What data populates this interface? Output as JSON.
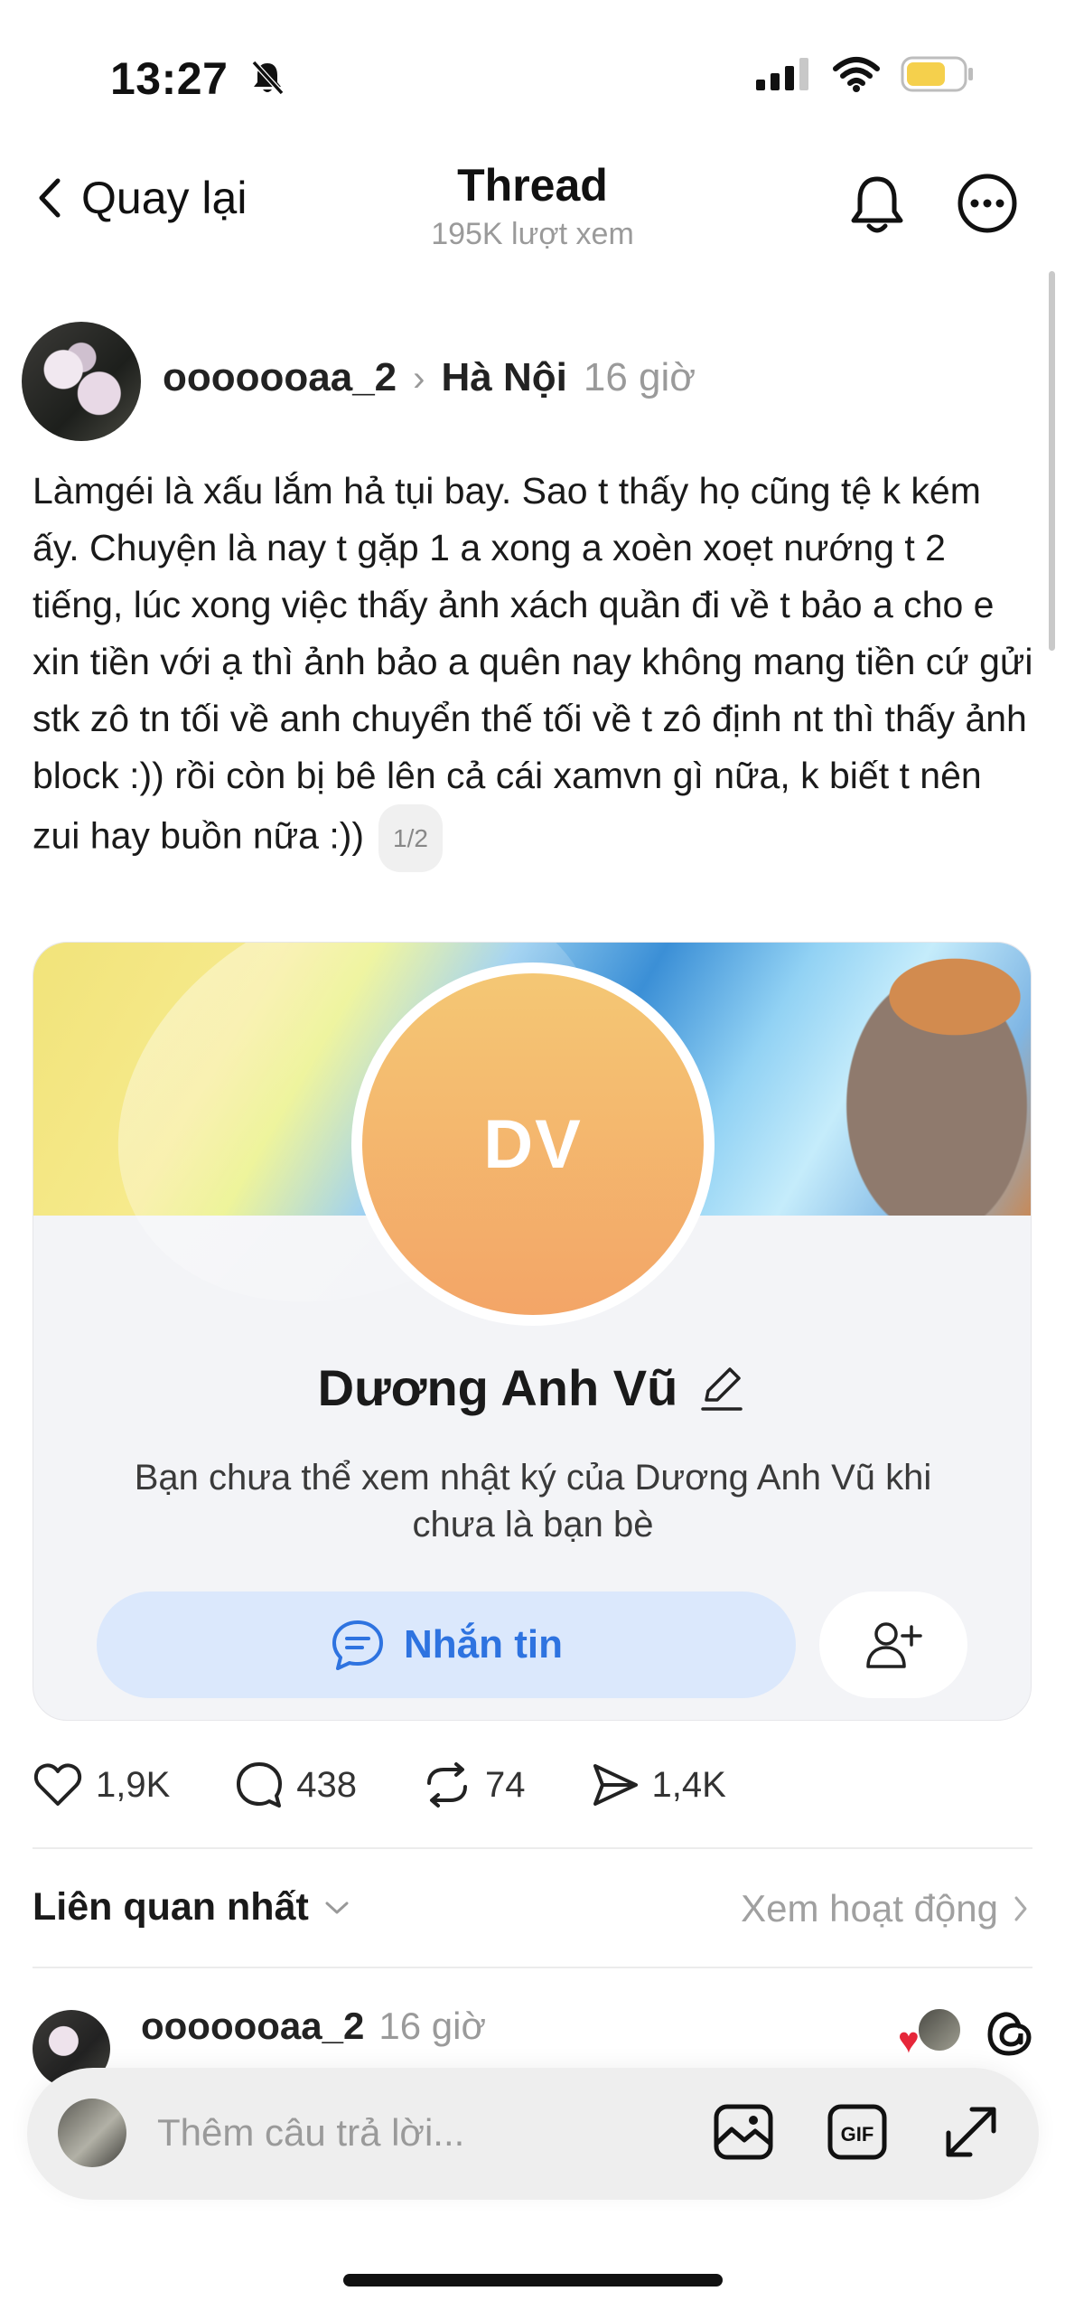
{
  "status_bar": {
    "time": "13:27",
    "battery_color": "#f5d04c"
  },
  "header": {
    "back_label": "Quay lại",
    "title": "Thread",
    "subtitle": "195K lượt xem"
  },
  "post": {
    "username": "ooooooaa_2",
    "location": "Hà Nội",
    "time": "16 giờ",
    "text": "Làmgéi là xấu lắm hả tụi bay. Sao t thấy họ cũng tệ k kém ấy. Chuyện là nay t gặp 1 a xong a xoèn xoẹt nướng t 2 tiếng, lúc xong việc thấy ảnh xách quần đi về t bảo a cho e xin tiền với ạ thì ảnh bảo a quên nay không mang tiền cứ gửi stk zô tn tối về anh chuyển thế tối về t zô định nt  thì thấy ảnh block :)) rồi còn bị bê lên cả cái xamvn gì nữa, k biết t nên zui hay buồn nữa :))",
    "page_indicator": "1/2"
  },
  "card": {
    "initials": "DV",
    "name": "Dương Anh Vũ",
    "message": "Bạn chưa thể xem nhật ký của Dương Anh Vũ khi chưa là bạn bè",
    "message_button": "Nhắn tin"
  },
  "actions": {
    "likes": "1,9K",
    "comments": "438",
    "reposts": "74",
    "shares": "1,4K"
  },
  "sort": {
    "label": "Liên quan nhất",
    "activity_link": "Xem hoạt động"
  },
  "reply": {
    "username": "ooooooaa_2",
    "time": "16 giờ"
  },
  "composer": {
    "placeholder": "Thêm câu trả lời..."
  }
}
